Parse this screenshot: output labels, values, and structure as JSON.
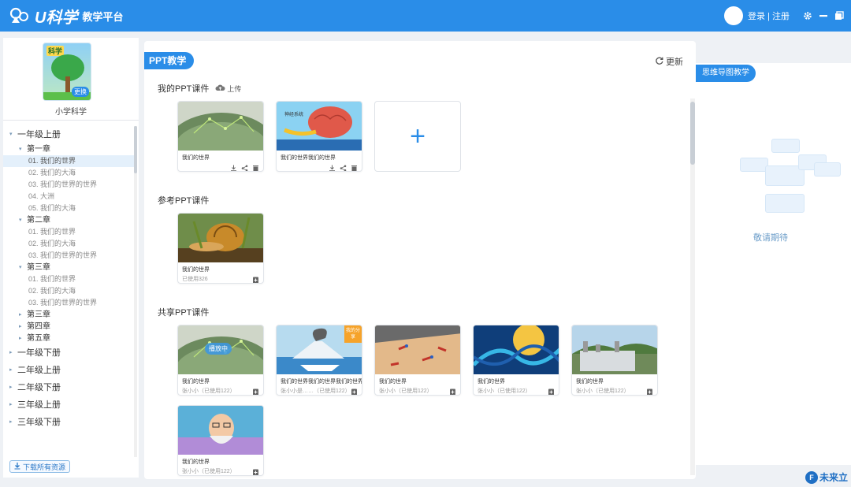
{
  "app": {
    "logo_u": "U科学",
    "logo_sub": "教学平台",
    "login": "登录 | 注册"
  },
  "sidebar": {
    "book_cover_title": "科学",
    "book_swap": "更换",
    "book_name": "小学科学",
    "tree": [
      {
        "kind": "grade",
        "label": "一年级上册",
        "expanded": true
      },
      {
        "kind": "chapter",
        "label": "第一章",
        "expanded": true
      },
      {
        "kind": "lesson",
        "label": "01. 我们的世界",
        "active": true
      },
      {
        "kind": "lesson",
        "label": "02. 我们的大海"
      },
      {
        "kind": "lesson",
        "label": "03. 我们的世界的世界"
      },
      {
        "kind": "lesson",
        "label": "04. 大洲"
      },
      {
        "kind": "lesson",
        "label": "05. 我们的大海"
      },
      {
        "kind": "chapter",
        "label": "第二章",
        "expanded": true
      },
      {
        "kind": "lesson",
        "label": "01. 我们的世界"
      },
      {
        "kind": "lesson",
        "label": "02. 我们的大海"
      },
      {
        "kind": "lesson",
        "label": "03. 我们的世界的世界"
      },
      {
        "kind": "chapter",
        "label": "第三章",
        "expanded": true
      },
      {
        "kind": "lesson",
        "label": "01. 我们的世界"
      },
      {
        "kind": "lesson",
        "label": "02. 我们的大海"
      },
      {
        "kind": "lesson",
        "label": "03. 我们的世界的世界"
      },
      {
        "kind": "chapter",
        "label": "第三章",
        "expanded": false
      },
      {
        "kind": "chapter",
        "label": "第四章",
        "expanded": false
      },
      {
        "kind": "chapter",
        "label": "第五章",
        "expanded": false
      },
      {
        "kind": "grade",
        "label": "一年级下册",
        "expanded": false
      },
      {
        "kind": "grade",
        "label": "二年级上册",
        "expanded": false
      },
      {
        "kind": "grade",
        "label": "二年级下册",
        "expanded": false
      },
      {
        "kind": "grade",
        "label": "三年级上册",
        "expanded": false
      },
      {
        "kind": "grade",
        "label": "三年级下册",
        "expanded": false
      }
    ],
    "download_label": "下载所有资源"
  },
  "main": {
    "tab": "PPT教学",
    "refresh": "更新",
    "my_section": "我的PPT课件",
    "upload": "上传",
    "ref_section": "参考PPT课件",
    "shared_section": "共享PPT课件",
    "my_cards": [
      {
        "title": "我们的世界",
        "thumb": "earth"
      },
      {
        "title": "我们的世界我们的世界",
        "thumb": "brain"
      }
    ],
    "ref_cards": [
      {
        "title": "我们的世界",
        "sub": "已使用326",
        "thumb": "snail"
      }
    ],
    "shared_cards": [
      {
        "title": "我们的世界",
        "sub": "张小小（已使用122）",
        "thumb": "earth",
        "badge": "播放中"
      },
      {
        "title": "我们的世界我们的世界我们的世界",
        "sub": "张小小是……（已使用122）",
        "thumb": "volcano",
        "corner": "我的分享"
      },
      {
        "title": "我们的世界",
        "sub": "张小小（已使用122）",
        "thumb": "table"
      },
      {
        "title": "我们的世界",
        "sub": "张小小（已使用122）",
        "thumb": "dna"
      },
      {
        "title": "我们的世界",
        "sub": "张小小（已使用122）",
        "thumb": "plant"
      },
      {
        "title": "我们的世界",
        "sub": "张小小（已使用122）",
        "thumb": "professor"
      }
    ]
  },
  "right": {
    "tab": "思维导图教学",
    "coming": "敬请期待"
  },
  "footer": {
    "brand": "未来立"
  }
}
